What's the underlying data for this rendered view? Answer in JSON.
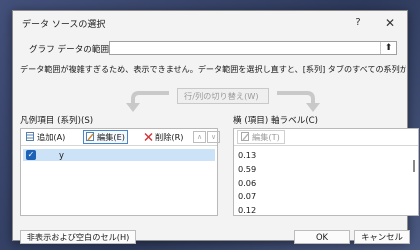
{
  "dialog": {
    "title": "データ ソースの選択",
    "help_glyph": "?",
    "close_glyph": "✕"
  },
  "range": {
    "label": "グラフ データの範囲(D):",
    "value": "",
    "collapse_glyph": "⬆"
  },
  "warning": "データ範囲が複雑すぎるため、表示できません。データ範囲を選択し直すと、[系列] タブのすべての系列が置き換えられます。",
  "switch_button_label": "行/列の切り替え(W)",
  "legend_section": {
    "label": "凡例項目 (系列)(S)",
    "add_label": "追加(A)",
    "edit_label": "編集(E)",
    "delete_label": "削除(R)",
    "up_glyph": "∧",
    "down_glyph": "∨",
    "series": [
      {
        "name": "y",
        "checked": true
      }
    ]
  },
  "axis_section": {
    "label": "横 (項目) 軸ラベル(C)",
    "edit_label": "編集(T)",
    "items": [
      "0.13",
      "0.59",
      "0.06",
      "0.07",
      "0.12"
    ]
  },
  "footer": {
    "hidden_cells_label": "非表示および空白のセル(H)",
    "ok_label": "OK",
    "cancel_label": "キャンセル"
  },
  "colors": {
    "accent": "#1c63b7",
    "selection": "#cce2f7"
  }
}
